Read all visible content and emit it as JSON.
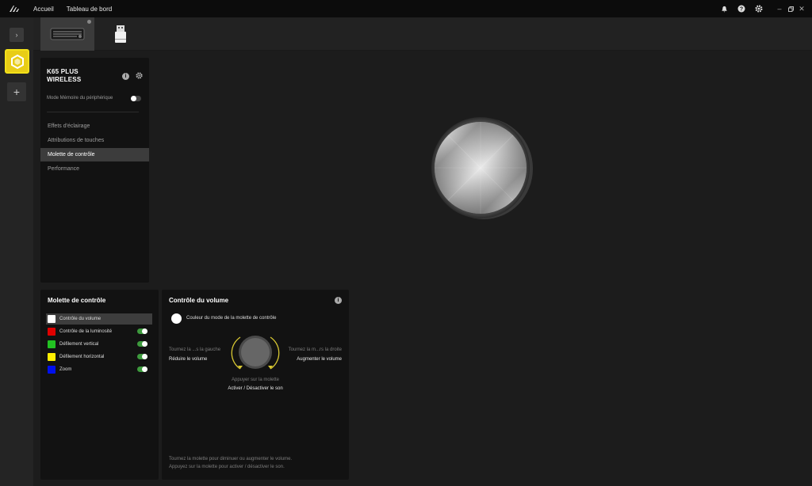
{
  "topbar": {
    "nav": [
      "Accueil",
      "Tableau de bord"
    ]
  },
  "device": {
    "name": "K65 PLUS WIRELESS",
    "memory_mode_label": "Mode Mémoire du périphérique",
    "memory_mode_on": false
  },
  "sidebar_nav": {
    "items": [
      "Effets d'éclairage",
      "Attributions de touches",
      "Molette de contrôle",
      "Performance"
    ],
    "active": "Molette de contrôle"
  },
  "wheel_list": {
    "title": "Molette de contrôle",
    "items": [
      {
        "label": "Contrôle du volume",
        "color": "#ffffff",
        "active": true
      },
      {
        "label": "Contrôle de la luminosité",
        "color": "#e00000",
        "enabled": true
      },
      {
        "label": "Défilement vertical",
        "color": "#22c222",
        "enabled": true
      },
      {
        "label": "Défilement horizontal",
        "color": "#ffee00",
        "enabled": true
      },
      {
        "label": "Zoom",
        "color": "#0010ee",
        "enabled": true
      }
    ]
  },
  "volume_panel": {
    "title": "Contrôle du volume",
    "color_label": "Couleur du mode de la molette de contrôle",
    "left_hint": "Tournez la ...s la gauche",
    "left_action": "Réduire le volume",
    "right_hint": "Tournez la m...rs la droite",
    "right_action": "Augmenter le volume",
    "press_hint": "Appuyer sur la molette",
    "press_action": "Activer / Désactiver le son",
    "footer_line1": "Tournez la molette pour diminuer ou augmenter le volume.",
    "footer_line2": "Appuyez sur la molette pour activer / désactiver le son."
  },
  "colors": {
    "accent_yellow": "#e8cd16",
    "toggle_green": "#3d9a3d",
    "arrow_yellow": "#d8c832"
  },
  "icons": [
    "corsair-logo-icon",
    "bell-icon",
    "help-icon",
    "settings-icon",
    "minimize-icon",
    "restore-icon",
    "close-icon",
    "chevron-right-icon",
    "device-hexagon-icon",
    "plus-icon",
    "keyboard-icon",
    "usb-dongle-icon",
    "info-icon",
    "gear-icon"
  ]
}
